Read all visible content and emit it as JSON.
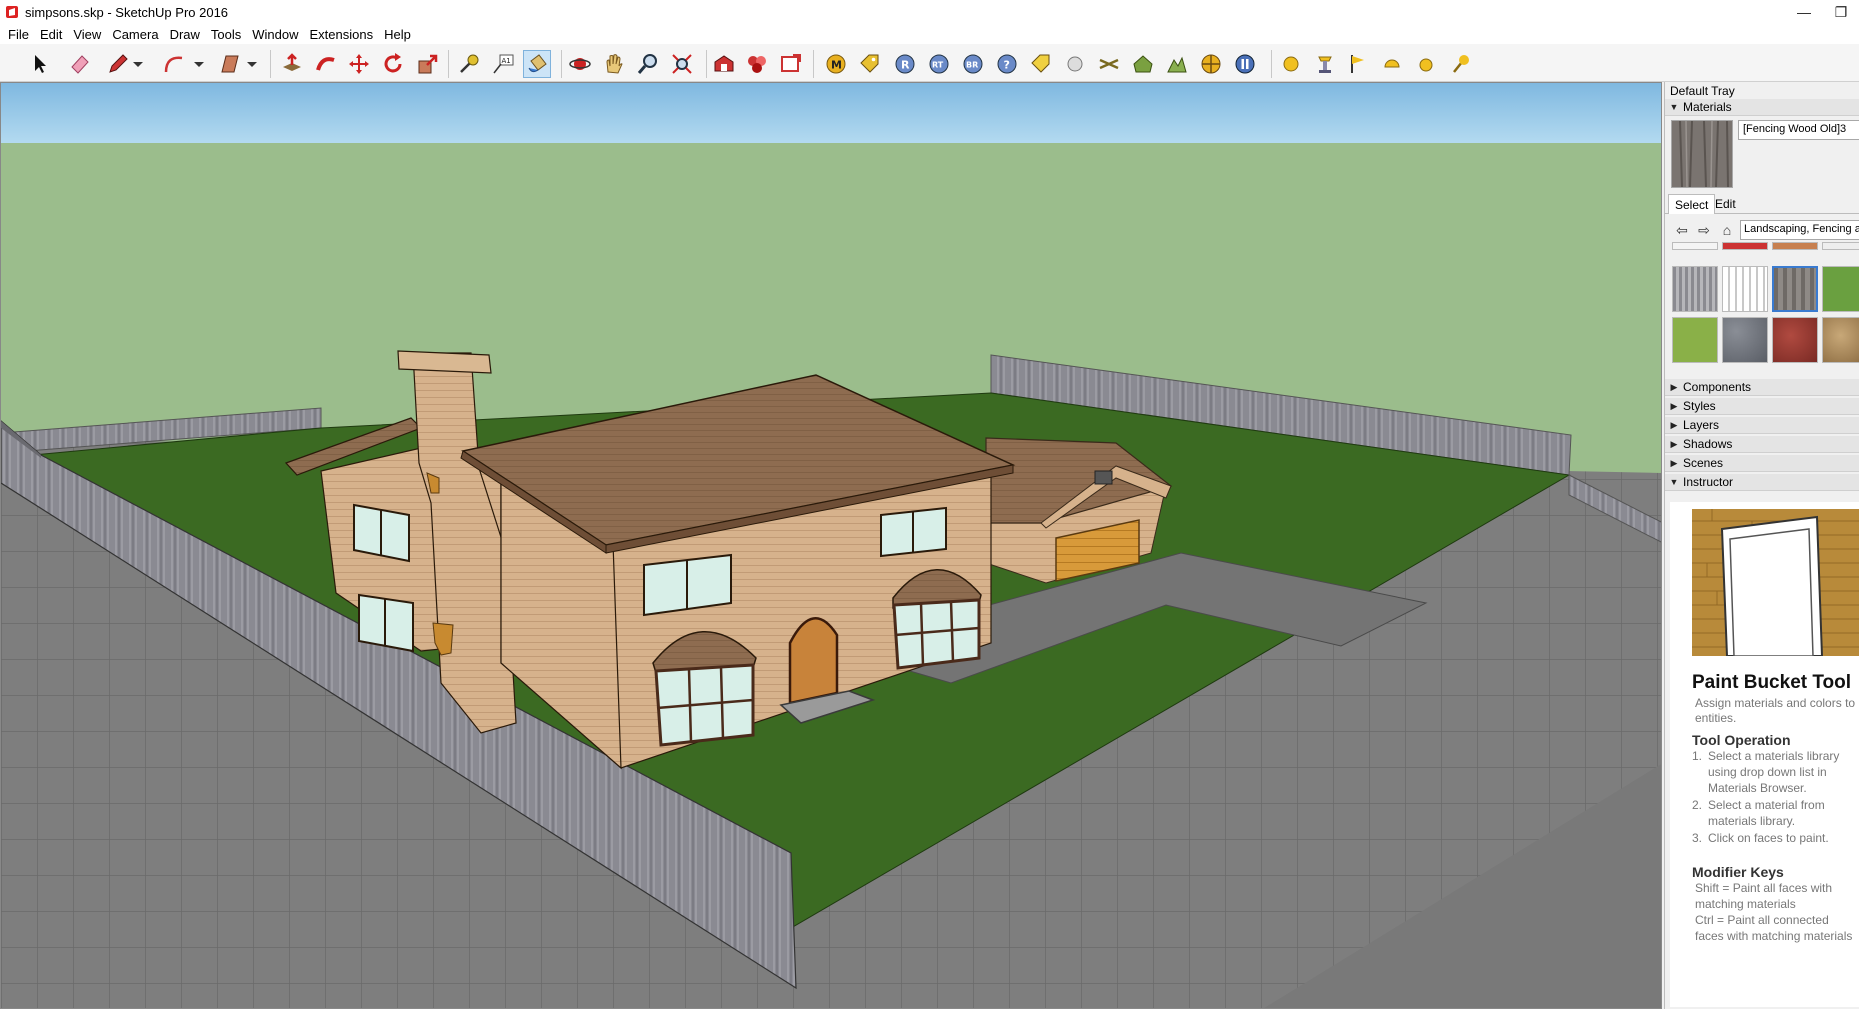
{
  "window": {
    "title": "simpsons.skp - SketchUp Pro 2016",
    "app_icon": "sketchup-logo-icon",
    "controls": [
      "minimize-icon",
      "restore-icon"
    ]
  },
  "menu": [
    "File",
    "Edit",
    "View",
    "Camera",
    "Draw",
    "Tools",
    "Window",
    "Extensions",
    "Help"
  ],
  "toolbar": {
    "active_tool": "paint-bucket",
    "icons": [
      "select-arrow",
      "eraser",
      "pencil",
      "arc",
      "rectangle",
      "push-pull",
      "follow-me",
      "move",
      "rotate",
      "scale",
      "tape-measure",
      "text",
      "paint-bucket",
      "orbit",
      "pan",
      "zoom",
      "zoom-extents",
      "warehouse",
      "extension-warehouse",
      "layout",
      "plugins"
    ]
  },
  "tray": {
    "title": "Default Tray",
    "materials": {
      "header": "Materials",
      "current_material": "[Fencing Wood Old]3",
      "tabs": [
        "Select",
        "Edit"
      ],
      "library": "Landscaping, Fencing and"
    },
    "panels": [
      "Components",
      "Styles",
      "Layers",
      "Shadows",
      "Scenes",
      "Instructor"
    ],
    "instructor": {
      "tool_name": "Paint Bucket Tool",
      "description": "Assign materials and colors to entities.",
      "operation_heading": "Tool Operation",
      "steps": [
        "Select a materials library using drop down list in Materials Browser.",
        "Select a material from materials library.",
        "Click on faces to paint."
      ],
      "modifier_heading": "Modifier Keys",
      "modifiers": [
        "Shift = Paint all faces with matching materials",
        "Ctrl = Paint all connected faces with matching materials"
      ]
    }
  },
  "colors": {
    "sky": "#9fcde9",
    "background": "#9bbd8c",
    "lawn": "#3c6b23",
    "fence": "#8a8a90",
    "house_wall": "#d3b08a",
    "roof": "#8c6a4e",
    "garage_door": "#d69a3a",
    "pavement": "#7e7e7e"
  }
}
